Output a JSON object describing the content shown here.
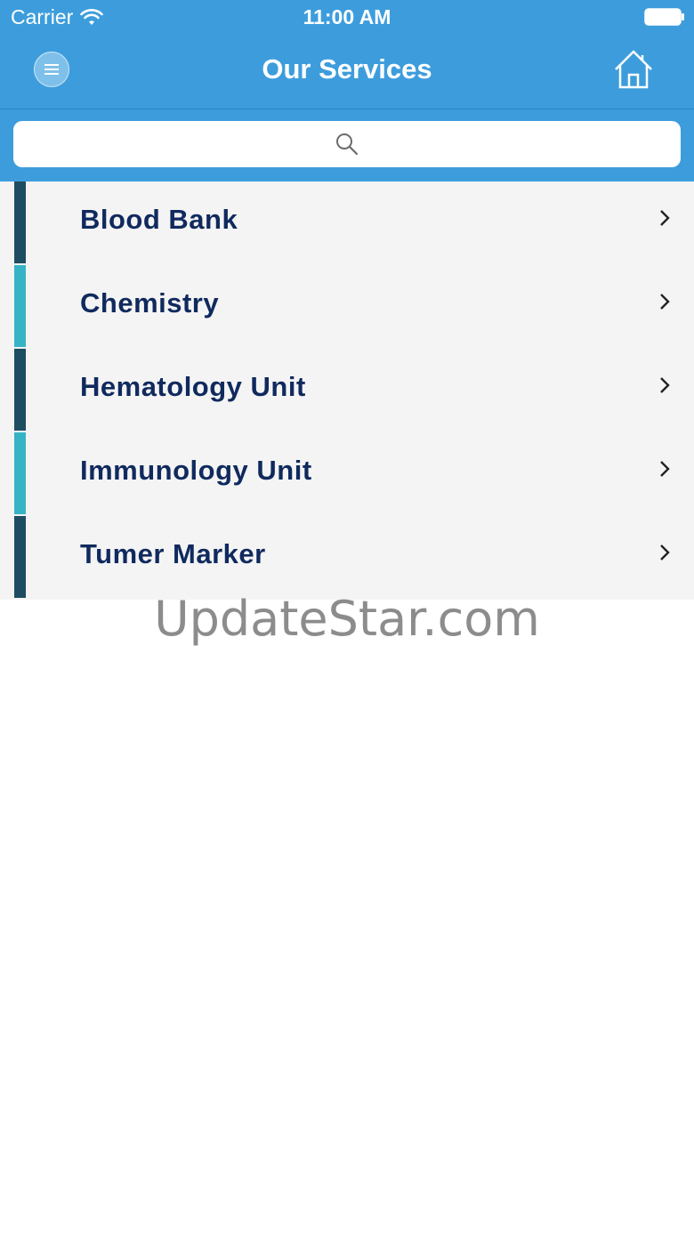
{
  "status_bar": {
    "carrier": "Carrier",
    "time": "11:00 AM",
    "icons": [
      "wifi-icon",
      "battery-icon"
    ]
  },
  "nav": {
    "title": "Our Services",
    "menu_icon": "menu-icon",
    "home_icon": "home-icon"
  },
  "search": {
    "placeholder": "",
    "value": "",
    "icon": "search-icon"
  },
  "services": [
    {
      "label": "Blood Bank",
      "accent": "#1e4d61"
    },
    {
      "label": "Chemistry",
      "accent": "#37b3c6"
    },
    {
      "label": "Hematology Unit",
      "accent": "#1e4d61"
    },
    {
      "label": "Immunology Unit",
      "accent": "#37b3c6"
    },
    {
      "label": "Tumer Marker",
      "accent": "#1e4d61"
    }
  ],
  "watermark": "UpdateStar.com",
  "colors": {
    "header": "#3d9ddc",
    "list_background": "#f4f4f4",
    "label_text": "#102a5e",
    "accent_dark": "#1e4d61",
    "accent_light": "#37b3c6"
  }
}
